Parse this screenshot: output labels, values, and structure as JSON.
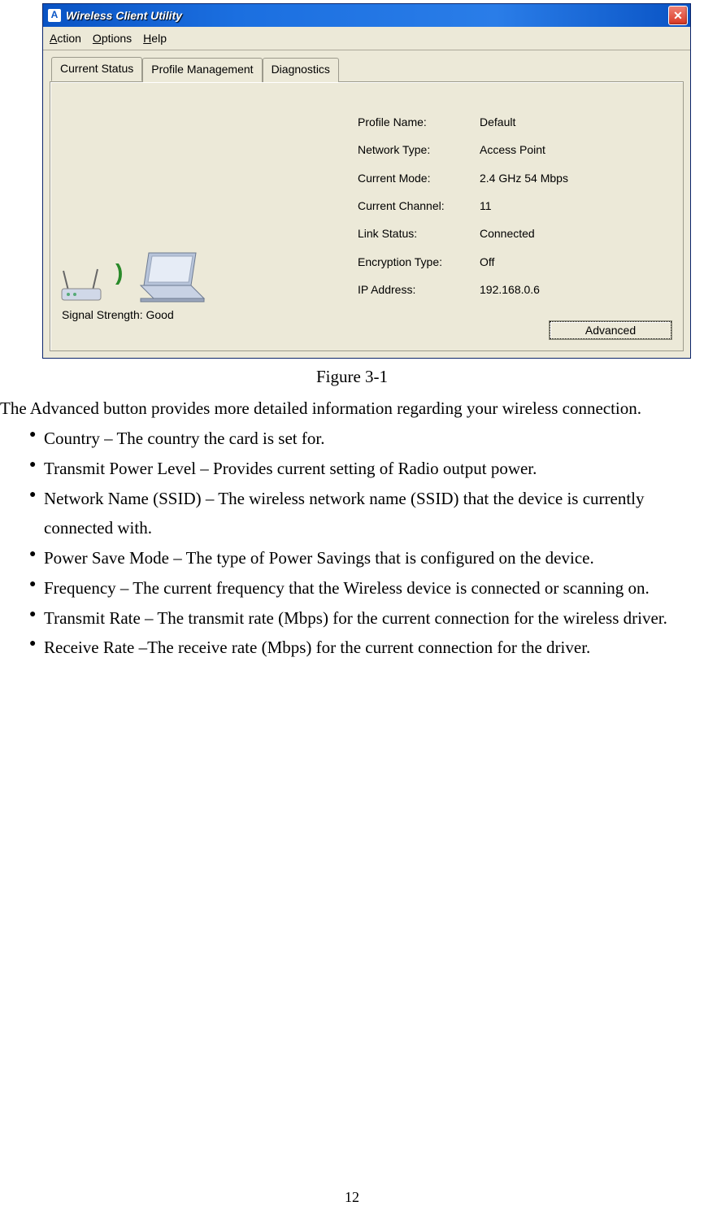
{
  "window": {
    "app_letter": "A",
    "title": "Wireless Client Utility",
    "menus": {
      "action": "Action",
      "options": "Options",
      "help": "Help"
    },
    "tabs": {
      "current_status": "Current Status",
      "profile_management": "Profile Management",
      "diagnostics": "Diagnostics"
    },
    "status": {
      "profile_name_label": "Profile Name:",
      "profile_name_value": "Default",
      "network_type_label": "Network Type:",
      "network_type_value": "Access Point",
      "current_mode_label": "Current Mode:",
      "current_mode_value": "2.4 GHz 54 Mbps",
      "current_channel_label": "Current Channel:",
      "current_channel_value": "11",
      "link_status_label": "Link Status:",
      "link_status_value": "Connected",
      "encryption_type_label": "Encryption Type:",
      "encryption_type_value": "Off",
      "ip_address_label": "IP Address:",
      "ip_address_value": "192.168.0.6"
    },
    "signal_label": "Signal Strength:  Good",
    "advanced_button": "Advanced"
  },
  "caption": "Figure 3-1",
  "intro": "The Advanced button provides more detailed information regarding your wireless connection.",
  "bullets": [
    "Country – The country the card is set for.",
    "Transmit Power Level – Provides current setting of Radio output power.",
    "Network Name (SSID) – The wireless network name (SSID) that the device is currently connected with.",
    "Power Save Mode – The type of Power Savings that is configured on the device.",
    "Frequency – The current frequency that the Wireless device is connected or scanning on.",
    "Transmit Rate – The transmit rate (Mbps) for the current connection for the wireless driver.",
    "Receive Rate –The receive rate (Mbps) for the current connection for the driver."
  ],
  "page_number": "12"
}
